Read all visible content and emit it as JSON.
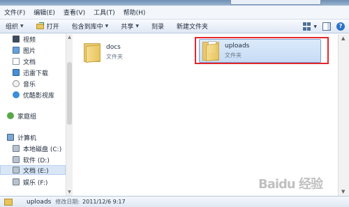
{
  "menu": [
    "文件(F)",
    "编辑(E)",
    "查看(V)",
    "工具(T)",
    "帮助(H)"
  ],
  "toolbar": {
    "organize": "组织",
    "open": "打开",
    "include_in_library": "包含到库中",
    "share": "共享",
    "burn": "刻录",
    "new_folder": "新建文件夹"
  },
  "nav": {
    "libraries": [
      "视频",
      "图片",
      "文档",
      "迅雷下载",
      "音乐",
      "优酷影视库"
    ],
    "homegroup": "家庭组",
    "computer": "计算机",
    "drives": [
      "本地磁盘 (C:)",
      "软件 (D:)",
      "文档 (E:)",
      "娱乐 (F:)"
    ]
  },
  "files": [
    {
      "name": "docs",
      "type": "文件夹"
    },
    {
      "name": "uploads",
      "type": "文件夹"
    }
  ],
  "status": {
    "name": "uploads",
    "modified_label": "修改日期:",
    "modified_value": "2011/12/6 9:17"
  },
  "watermark": "Baidu 经验",
  "colors": {
    "highlight_box": "#e3262b",
    "selection": "#c7dcf5",
    "folder": "#e7c45e"
  },
  "icons": [
    "folder-icon",
    "video-icon",
    "picture-icon",
    "document-icon",
    "download-icon",
    "music-icon",
    "library-icon",
    "homegroup-icon",
    "computer-icon",
    "drive-icon",
    "views-icon",
    "preview-pane-icon",
    "help-icon"
  ]
}
